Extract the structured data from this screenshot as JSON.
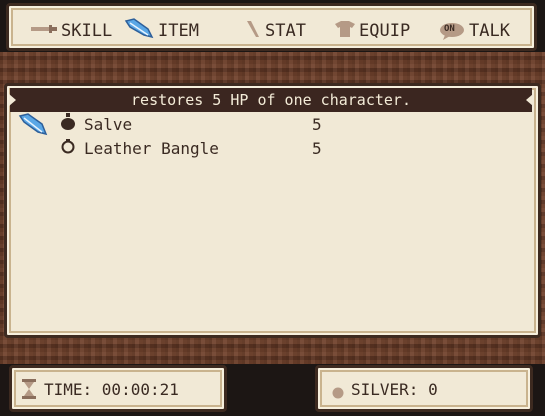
{
  "menu": {
    "skill_label": "SKILL",
    "item_label": "ITEM",
    "stat_label": "STAT",
    "equip_label": "EQUIP",
    "talk_label": "TALK",
    "talk_icon_text": "ON"
  },
  "description": "restores 5 HP of one character.",
  "items": [
    {
      "name": "Salve",
      "qty": "5",
      "icon": "pouch-icon"
    },
    {
      "name": "Leather Bangle",
      "qty": "5",
      "icon": "ring-icon"
    }
  ],
  "footer": {
    "time_label": "TIME: 00:00:21",
    "silver_label": "SILVER: 0"
  },
  "colors": {
    "panel_bg": "#f1e9d6",
    "border": "#3d2a20",
    "desc_bar": "#3b2620",
    "feather_blue": "#5aa7e6"
  }
}
